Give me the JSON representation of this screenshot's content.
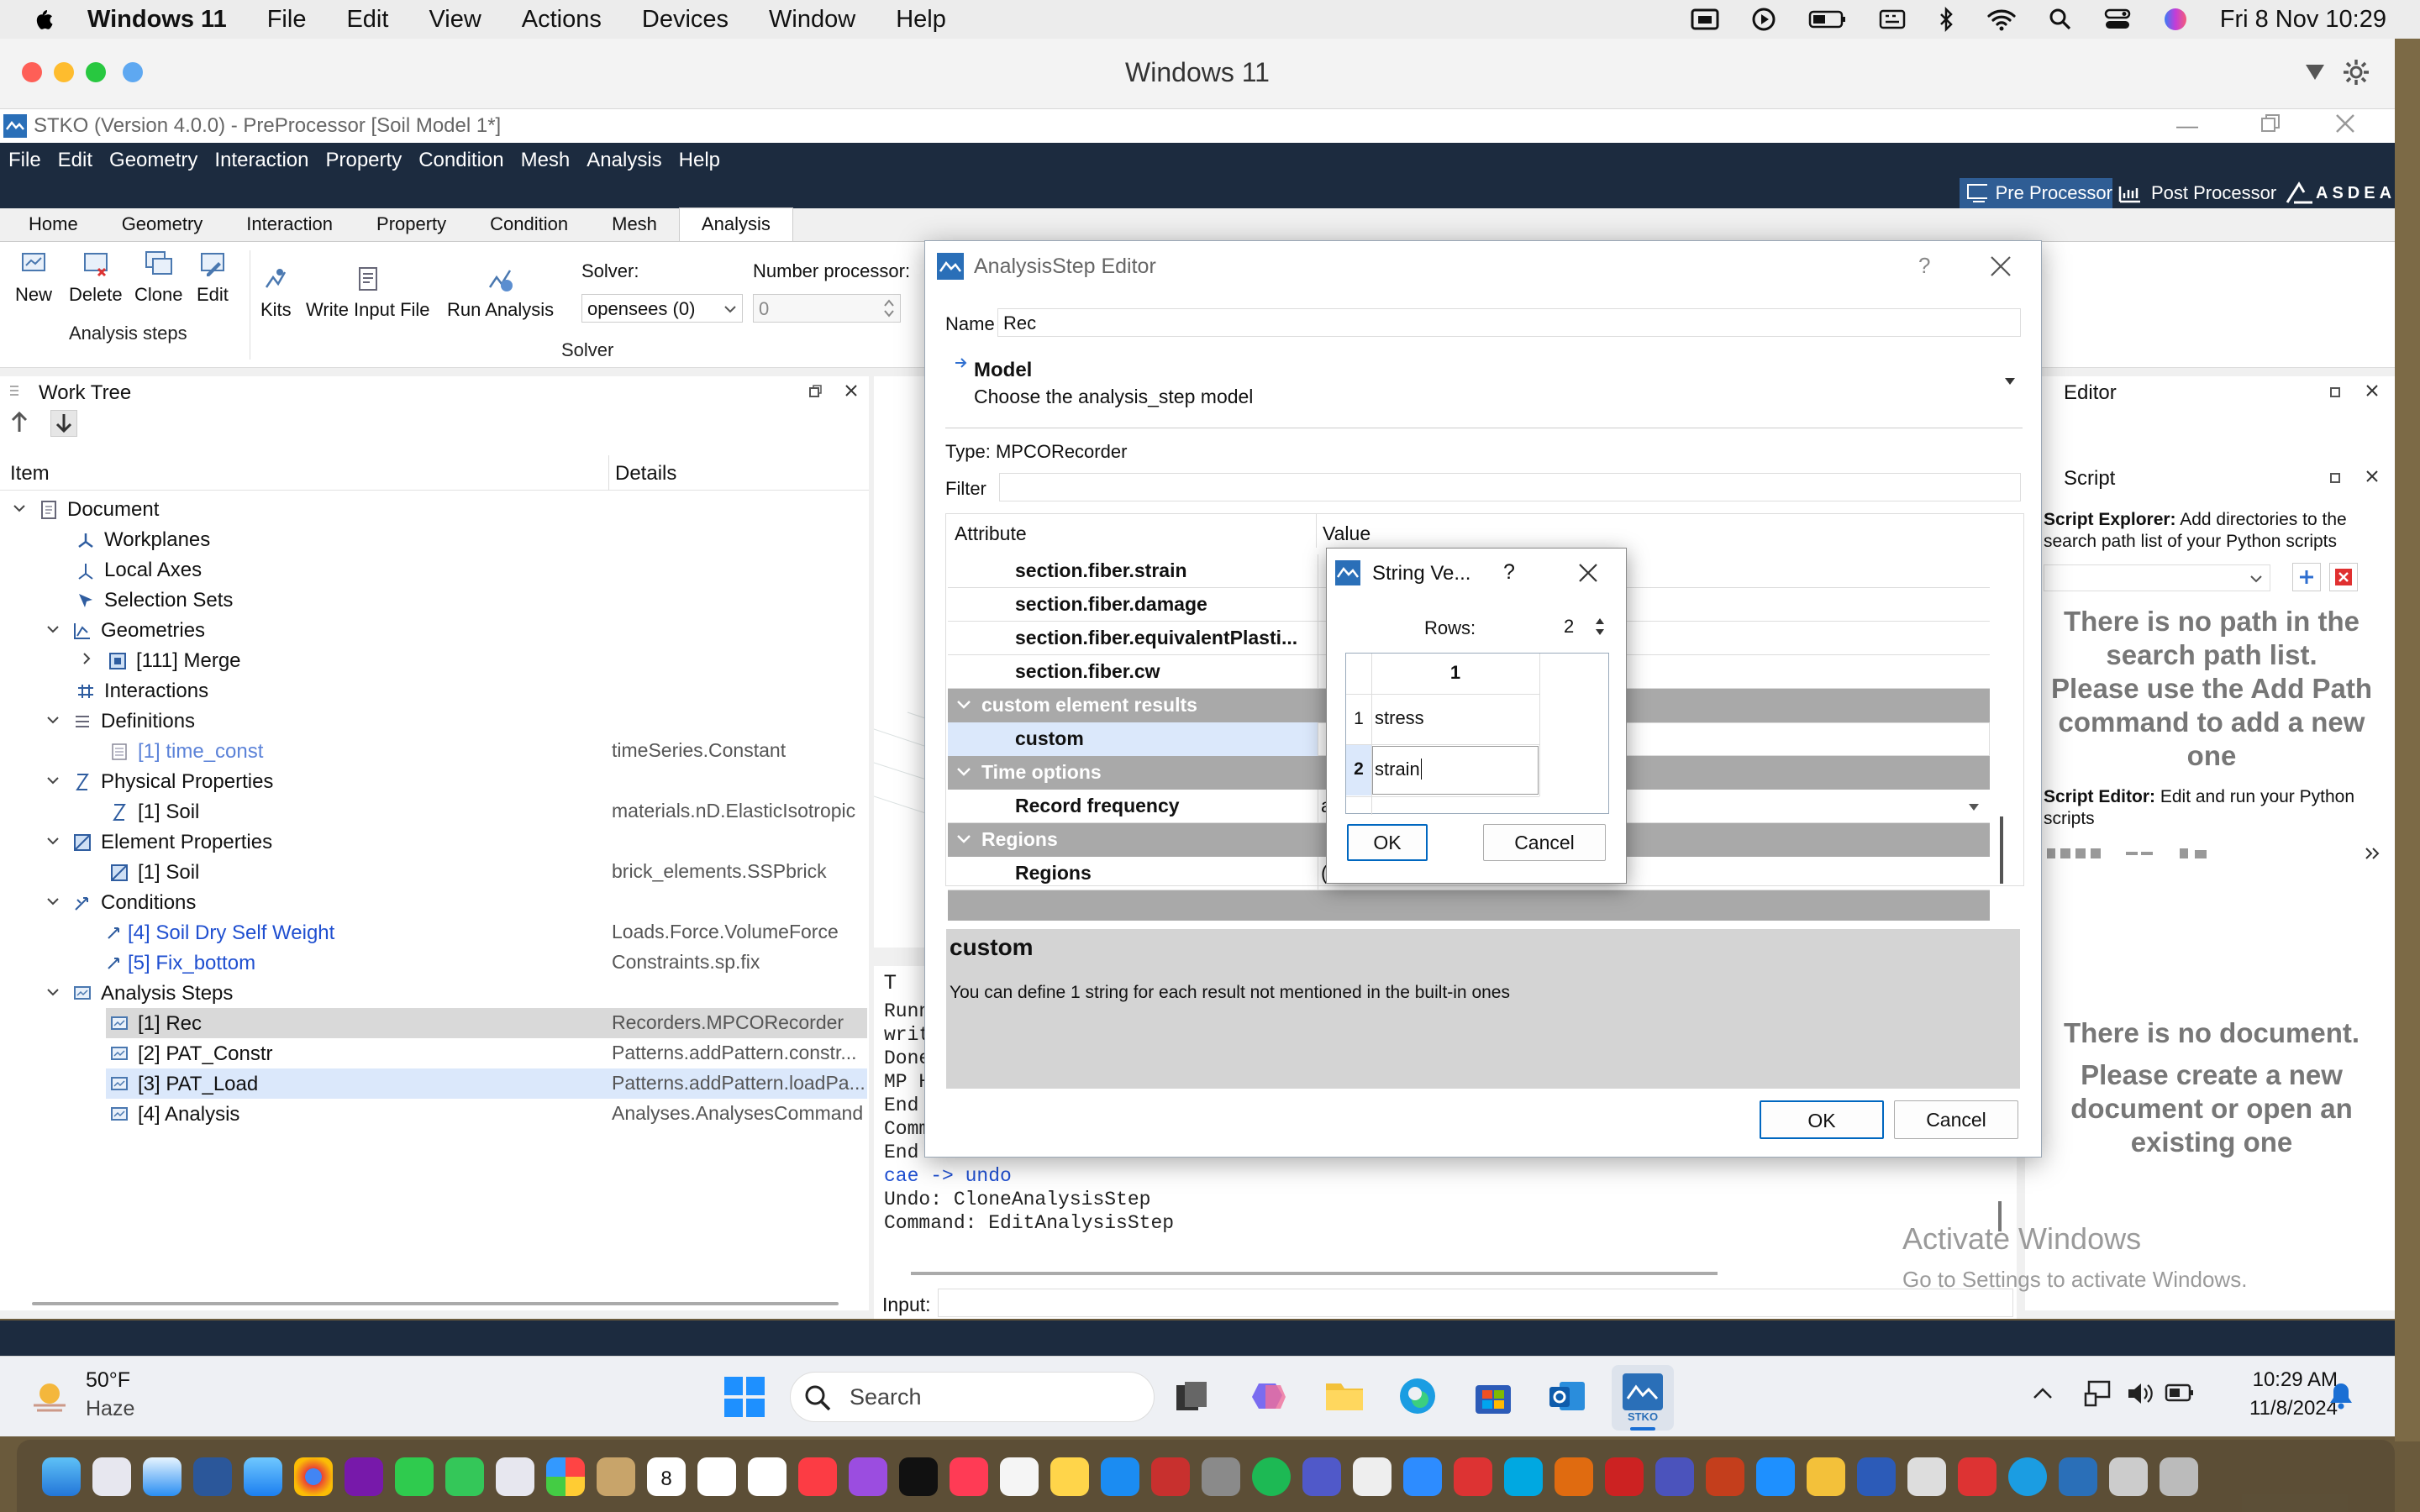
{
  "mac_menubar": {
    "app_name": "Windows 11",
    "items": [
      "File",
      "Edit",
      "View",
      "Actions",
      "Devices",
      "Window",
      "Help"
    ],
    "clock": "Fri 8 Nov  10:29"
  },
  "vm_window": {
    "title": "Windows 11"
  },
  "app": {
    "title": "STKO (Version 4.0.0) - PreProcessor [Soil Model 1*]",
    "menu": [
      "File",
      "Edit",
      "Geometry",
      "Interaction",
      "Property",
      "Condition",
      "Mesh",
      "Analysis",
      "Help"
    ],
    "pre_processor": "Pre Processor",
    "post_processor": "Post Processor",
    "brand": "ASDEA",
    "ribbon_tabs": [
      "Home",
      "Geometry",
      "Interaction",
      "Property",
      "Condition",
      "Mesh",
      "Analysis"
    ],
    "ribbon": {
      "new": "New",
      "delete": "Delete",
      "clone": "Clone",
      "edit": "Edit",
      "group_analysis_steps": "Analysis steps",
      "kits": "Kits",
      "write_input": "Write Input File",
      "run": "Run Analysis",
      "solver_label": "Solver:",
      "solver_value": "opensees (0)",
      "nproc_label": "Number processor:",
      "nproc_value": "0",
      "group_solver": "Solver"
    }
  },
  "work_tree": {
    "title": "Work Tree",
    "col_item": "Item",
    "col_details": "Details",
    "rows": [
      {
        "label": "Document",
        "details": ""
      },
      {
        "label": "Workplanes",
        "details": ""
      },
      {
        "label": "Local Axes",
        "details": ""
      },
      {
        "label": "Selection Sets",
        "details": ""
      },
      {
        "label": "Geometries",
        "details": ""
      },
      {
        "label": "[111] Merge",
        "details": ""
      },
      {
        "label": "Interactions",
        "details": ""
      },
      {
        "label": "Definitions",
        "details": ""
      },
      {
        "label": "[1] time_const",
        "details": "timeSeries.Constant"
      },
      {
        "label": "Physical Properties",
        "details": ""
      },
      {
        "label": "[1] Soil",
        "details": "materials.nD.ElasticIsotropic"
      },
      {
        "label": "Element Properties",
        "details": ""
      },
      {
        "label": "[1] Soil",
        "details": "brick_elements.SSPbrick"
      },
      {
        "label": "Conditions",
        "details": ""
      },
      {
        "label": "[4] Soil Dry Self Weight",
        "details": "Loads.Force.VolumeForce"
      },
      {
        "label": "[5] Fix_bottom",
        "details": "Constraints.sp.fix"
      },
      {
        "label": "Analysis Steps",
        "details": ""
      },
      {
        "label": "[1] Rec",
        "details": "Recorders.MPCORecorder"
      },
      {
        "label": "[2] PAT_Constr",
        "details": "Patterns.addPattern.constr..."
      },
      {
        "label": "[3] PAT_Load",
        "details": "Patterns.addPattern.loadPa..."
      },
      {
        "label": "[4] Analysis",
        "details": "Analyses.AnalysesCommand"
      }
    ]
  },
  "terminal": {
    "tab_initial": "T",
    "lines_partial": [
      "Runn",
      "writ",
      "Done",
      "MP H",
      "End",
      "Comm",
      "End"
    ],
    "line_undo_cmd": "cae -> undo",
    "line_undo": "Undo: CloneAnalysisStep",
    "line_cmd": "Command: EditAnalysisStep",
    "input_label": "Input:"
  },
  "editor_panel": {
    "title": "Editor",
    "script_title": "Script",
    "explorer_bold": "Script Explorer:",
    "explorer_text": "Add directories to the search path list of your Python scripts",
    "no_path": "There is no path in the search path list.",
    "use_add": "Please use the Add Path command to add a new one",
    "editor_bold": "Script Editor:",
    "editor_text": "Edit and run your Python scripts",
    "no_doc": "There is no document.",
    "create_doc": "Please create a new document or open an existing one"
  },
  "watermark": {
    "line1": "Activate Windows",
    "line2": "Go to Settings to activate Windows."
  },
  "dialog": {
    "title": "AnalysisStep Editor",
    "help": "?",
    "name_label": "Name",
    "name_value": "Rec",
    "model_title": "Model",
    "model_sub": "Choose the analysis_step model",
    "type_label": "Type:",
    "type_value": "MPCORecorder",
    "filter_label": "Filter",
    "col_attr": "Attribute",
    "col_value": "Value",
    "rows": [
      {
        "kind": "attr",
        "label": "section.fiber.strain"
      },
      {
        "kind": "attr",
        "label": "section.fiber.damage"
      },
      {
        "kind": "attr",
        "label": "section.fiber.equivalentPlasti..."
      },
      {
        "kind": "attr",
        "label": "section.fiber.cw"
      },
      {
        "kind": "section",
        "label": "custom element results"
      },
      {
        "kind": "attr",
        "label": "custom"
      },
      {
        "kind": "section",
        "label": "Time options"
      },
      {
        "kind": "attr",
        "label": "Record frequency",
        "value": "a"
      },
      {
        "kind": "section",
        "label": "Regions"
      },
      {
        "kind": "attr",
        "label": "Regions",
        "value": "("
      }
    ],
    "desc_title": "custom",
    "desc_text": "You can define 1 string for each result not mentioned in the built-in ones",
    "ok": "OK",
    "cancel": "Cancel"
  },
  "string_dialog": {
    "title": "String Ve...",
    "help": "?",
    "rows_label": "Rows:",
    "rows_value": "2",
    "col_header": "1",
    "row_numbers": [
      "1",
      "2"
    ],
    "values": [
      "stress",
      "strain"
    ],
    "ok": "OK",
    "cancel": "Cancel"
  },
  "taskbar": {
    "weather_temp": "50°F",
    "weather_desc": "Haze",
    "search": "Search",
    "stko": "STKO",
    "time": "10:29 AM",
    "date": "11/8/2024"
  },
  "dock": {
    "calendar_day": "8"
  },
  "colors": {
    "app_dark": "#1c2b3f",
    "selected": "#dbe8fb",
    "section": "#a9a9a9",
    "accent": "#0067c0"
  }
}
